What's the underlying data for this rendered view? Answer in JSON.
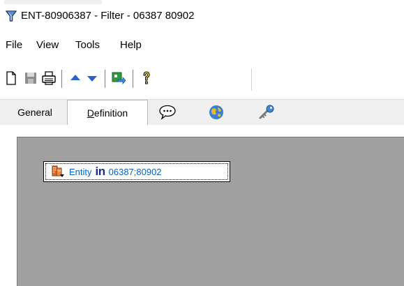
{
  "window": {
    "title": "ENT-80906387 - Filter - 06387 80902",
    "icon": "filter-icon"
  },
  "menu": {
    "items": [
      "File",
      "View",
      "Tools",
      "Help"
    ]
  },
  "toolbar": {
    "buttons": [
      "new-document-icon",
      "save-icon",
      "print-icon",
      "arrow-up-icon",
      "arrow-down-icon",
      "export-icon",
      "help-icon"
    ]
  },
  "tabs": {
    "items": [
      {
        "label": "General",
        "active": false
      },
      {
        "label": "Definition",
        "active": true
      },
      {
        "icon": "comment-icon"
      },
      {
        "icon": "globe-icon"
      },
      {
        "icon": "key-icon"
      }
    ]
  },
  "filter": {
    "node": {
      "icon": "entity-icon",
      "label": "Entity",
      "operator": "in",
      "value": "06387;80902"
    }
  },
  "colors": {
    "canvas": "#a0a0a0",
    "link": "#0563c1",
    "operator": "#1d2a8a"
  }
}
